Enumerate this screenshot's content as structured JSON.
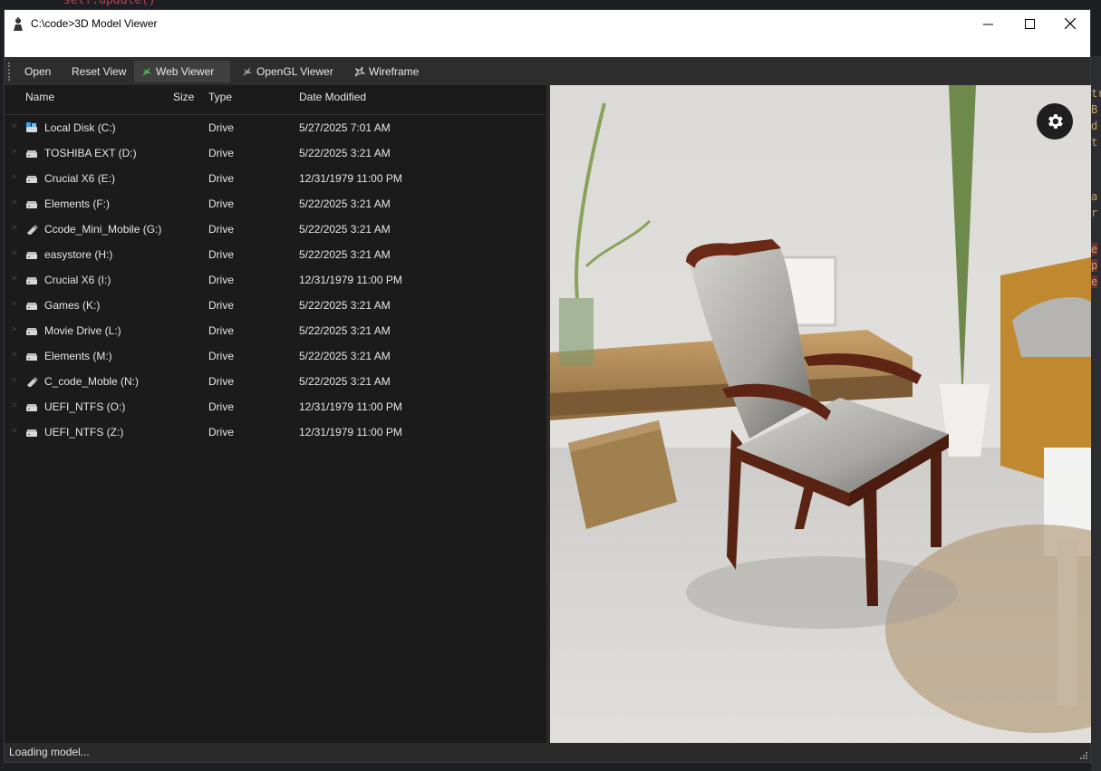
{
  "window": {
    "title": "C:\\code>3D Model Viewer",
    "controls": {
      "minimize": "—",
      "maximize": "☐",
      "close": "✕"
    }
  },
  "toolbar": {
    "open_label": "Open",
    "reset_view_label": "Reset View",
    "web_viewer_label": "Web Viewer",
    "opengl_viewer_label": "OpenGL Viewer",
    "wireframe_label": "Wireframe",
    "active_item": "Web Viewer"
  },
  "file_tree": {
    "columns": {
      "name": "Name",
      "size": "Size",
      "type": "Type",
      "date": "Date Modified"
    },
    "rows": [
      {
        "name": "Local Disk (C:)",
        "size": "",
        "type": "Drive",
        "date": "5/27/2025 7:01 AM",
        "icon": "system-drive-icon"
      },
      {
        "name": "TOSHIBA EXT (D:)",
        "size": "",
        "type": "Drive",
        "date": "5/22/2025 3:21 AM",
        "icon": "drive-icon"
      },
      {
        "name": "Crucial X6 (E:)",
        "size": "",
        "type": "Drive",
        "date": "12/31/1979 11:00 PM",
        "icon": "drive-icon"
      },
      {
        "name": "Elements (F:)",
        "size": "",
        "type": "Drive",
        "date": "5/22/2025 3:21 AM",
        "icon": "drive-icon"
      },
      {
        "name": "Ccode_Mini_Mobile (G:)",
        "size": "",
        "type": "Drive",
        "date": "5/22/2025 3:21 AM",
        "icon": "usb-drive-icon"
      },
      {
        "name": "easystore (H:)",
        "size": "",
        "type": "Drive",
        "date": "5/22/2025 3:21 AM",
        "icon": "drive-icon"
      },
      {
        "name": "Crucial X6 (I:)",
        "size": "",
        "type": "Drive",
        "date": "12/31/1979 11:00 PM",
        "icon": "drive-icon"
      },
      {
        "name": "Games (K:)",
        "size": "",
        "type": "Drive",
        "date": "5/22/2025 3:21 AM",
        "icon": "drive-icon"
      },
      {
        "name": "Movie Drive (L:)",
        "size": "",
        "type": "Drive",
        "date": "5/22/2025 3:21 AM",
        "icon": "drive-icon"
      },
      {
        "name": "Elements (M:)",
        "size": "",
        "type": "Drive",
        "date": "5/22/2025 3:21 AM",
        "icon": "drive-icon"
      },
      {
        "name": "C_code_Moble (N:)",
        "size": "",
        "type": "Drive",
        "date": "5/22/2025 3:21 AM",
        "icon": "usb-drive-icon"
      },
      {
        "name": "UEFI_NTFS (O:)",
        "size": "",
        "type": "Drive",
        "date": "12/31/1979 11:00 PM",
        "icon": "drive-icon"
      },
      {
        "name": "UEFI_NTFS (Z:)",
        "size": "",
        "type": "Drive",
        "date": "12/31/1979 11:00 PM",
        "icon": "drive-icon"
      }
    ]
  },
  "viewer": {
    "settings_icon": "gear-icon",
    "scene": "3D model of a wooden armchair with grey upholstery in a living room"
  },
  "status": {
    "text": "Loading model..."
  },
  "background": {
    "code_snippet": "self.update()"
  },
  "colors": {
    "toolbar_bg": "#2d2d2d",
    "pane_bg": "#1b1b1c",
    "accent_green": "#4caf50"
  }
}
